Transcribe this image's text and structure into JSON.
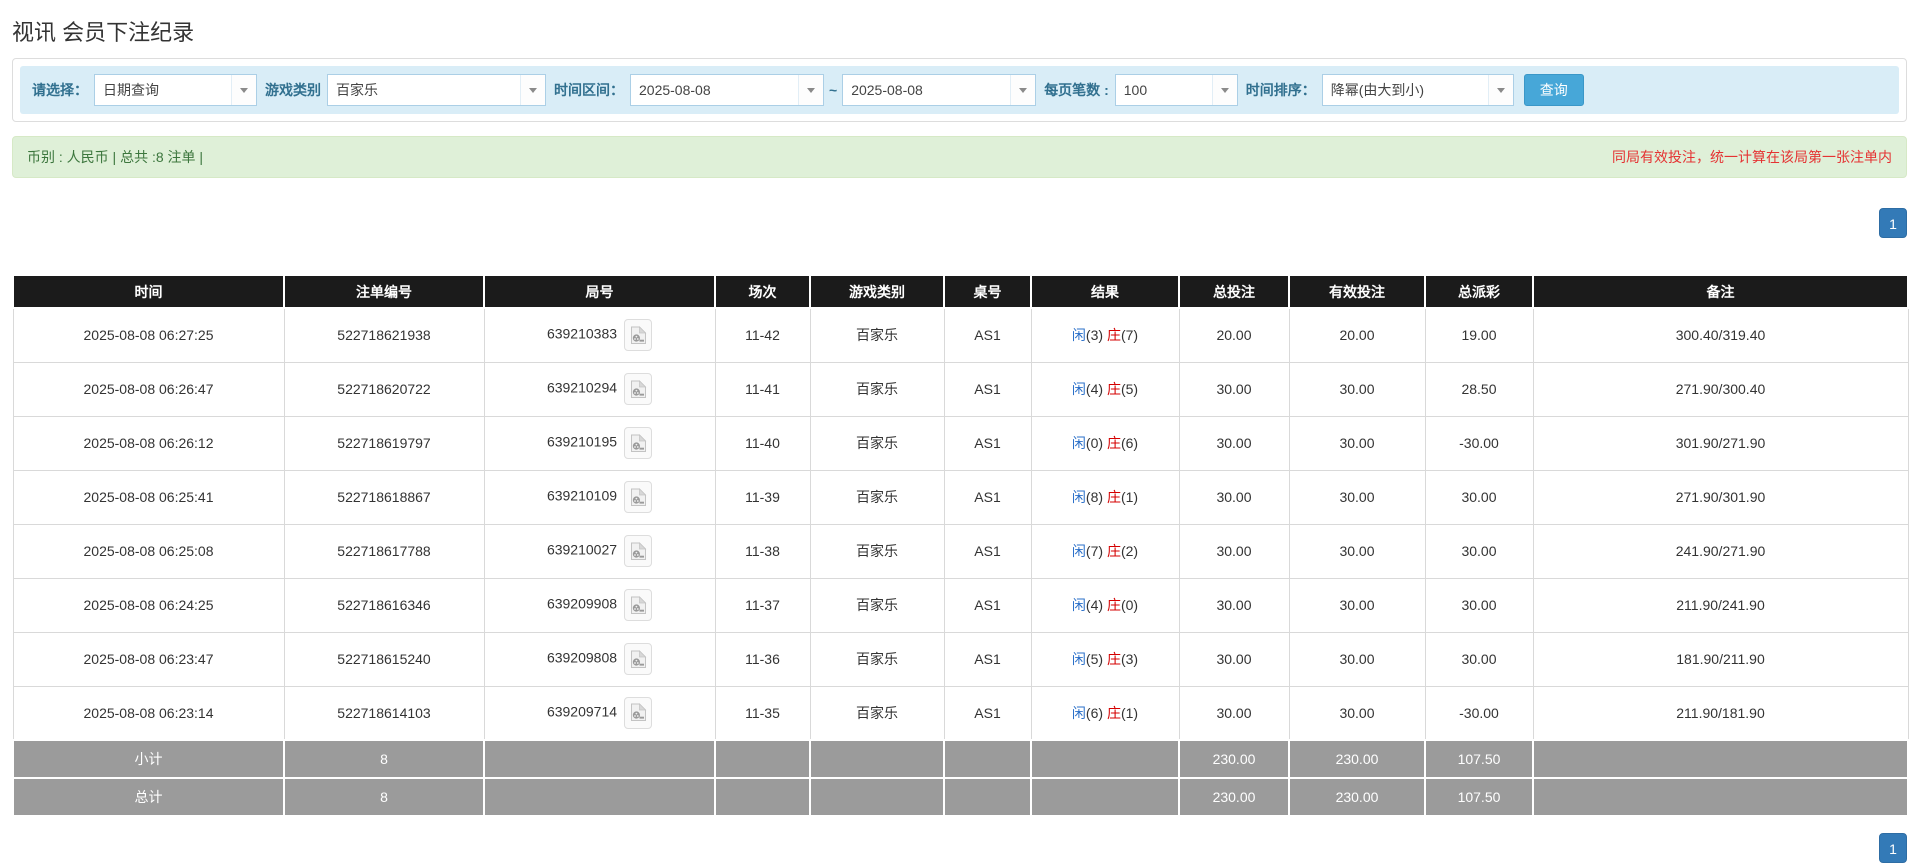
{
  "page": {
    "title": "视讯 会员下注纪录"
  },
  "filters": {
    "select_label": "请选择：",
    "select_value": "日期查询",
    "game_type_label": "游戏类别",
    "game_type_value": "百家乐",
    "date_range_label": "时间区间：",
    "date_from": "2025-08-08",
    "range_separator": "~",
    "date_to": "2025-08-08",
    "page_size_label": "每页笔数 :",
    "page_size_value": "100",
    "sort_label": "时间排序：",
    "sort_value": "降幂(由大到小)",
    "search_button": "查询"
  },
  "summary": {
    "left_text": "币别 : 人民币 | 总共 :8 注单 |",
    "right_text": "同局有效投注，统一计算在该局第一张注单内"
  },
  "pagination": {
    "current_page": "1"
  },
  "icons": {
    "video_icon": "video-clip-icon",
    "dropdown_icon": "chevron-down-icon"
  },
  "colors": {
    "accent_blue": "#47a7d8",
    "filter_bg": "#d9edf7",
    "filter_label": "#31708f",
    "summary_bg": "#dff0d8",
    "summary_text": "#3c763d",
    "warning_red": "#e53333",
    "header_bg": "#1b1b1b",
    "totals_bg": "#9b9b9b",
    "link_blue": "#337ab7",
    "player_blue": "#2a6fc9",
    "banker_red": "#d40000",
    "negative_red": "#e60000",
    "pager_blue": "#337ab7"
  },
  "table": {
    "headers": [
      "时间",
      "注单编号",
      "局号",
      "场次",
      "游戏类别",
      "桌号",
      "结果",
      "总投注",
      "有效投注",
      "总派彩",
      "备注"
    ],
    "rows": [
      {
        "time": "2025-08-08 06:27:25",
        "bet_id": "522718621938",
        "round_id": "639210383",
        "session": "11-42",
        "game": "百家乐",
        "table_no": "AS1",
        "player_label": "闲",
        "player_score": "(3)",
        "banker_label": "庄",
        "banker_score": "(7)",
        "total_bet": "20.00",
        "valid_bet": "20.00",
        "payout": "19.00",
        "remark": "300.40/319.40"
      },
      {
        "time": "2025-08-08 06:26:47",
        "bet_id": "522718620722",
        "round_id": "639210294",
        "session": "11-41",
        "game": "百家乐",
        "table_no": "AS1",
        "player_label": "闲",
        "player_score": "(4)",
        "banker_label": "庄",
        "banker_score": "(5)",
        "total_bet": "30.00",
        "valid_bet": "30.00",
        "payout": "28.50",
        "remark": "271.90/300.40"
      },
      {
        "time": "2025-08-08 06:26:12",
        "bet_id": "522718619797",
        "round_id": "639210195",
        "session": "11-40",
        "game": "百家乐",
        "table_no": "AS1",
        "player_label": "闲",
        "player_score": "(0)",
        "banker_label": "庄",
        "banker_score": "(6)",
        "total_bet": "30.00",
        "valid_bet": "30.00",
        "payout": "-30.00",
        "remark": "301.90/271.90"
      },
      {
        "time": "2025-08-08 06:25:41",
        "bet_id": "522718618867",
        "round_id": "639210109",
        "session": "11-39",
        "game": "百家乐",
        "table_no": "AS1",
        "player_label": "闲",
        "player_score": "(8)",
        "banker_label": "庄",
        "banker_score": "(1)",
        "total_bet": "30.00",
        "valid_bet": "30.00",
        "payout": "30.00",
        "remark": "271.90/301.90"
      },
      {
        "time": "2025-08-08 06:25:08",
        "bet_id": "522718617788",
        "round_id": "639210027",
        "session": "11-38",
        "game": "百家乐",
        "table_no": "AS1",
        "player_label": "闲",
        "player_score": "(7)",
        "banker_label": "庄",
        "banker_score": "(2)",
        "total_bet": "30.00",
        "valid_bet": "30.00",
        "payout": "30.00",
        "remark": "241.90/271.90"
      },
      {
        "time": "2025-08-08 06:24:25",
        "bet_id": "522718616346",
        "round_id": "639209908",
        "session": "11-37",
        "game": "百家乐",
        "table_no": "AS1",
        "player_label": "闲",
        "player_score": "(4)",
        "banker_label": "庄",
        "banker_score": "(0)",
        "total_bet": "30.00",
        "valid_bet": "30.00",
        "payout": "30.00",
        "remark": "211.90/241.90"
      },
      {
        "time": "2025-08-08 06:23:47",
        "bet_id": "522718615240",
        "round_id": "639209808",
        "session": "11-36",
        "game": "百家乐",
        "table_no": "AS1",
        "player_label": "闲",
        "player_score": "(5)",
        "banker_label": "庄",
        "banker_score": "(3)",
        "total_bet": "30.00",
        "valid_bet": "30.00",
        "payout": "30.00",
        "remark": "181.90/211.90"
      },
      {
        "time": "2025-08-08 06:23:14",
        "bet_id": "522718614103",
        "round_id": "639209714",
        "session": "11-35",
        "game": "百家乐",
        "table_no": "AS1",
        "player_label": "闲",
        "player_score": "(6)",
        "banker_label": "庄",
        "banker_score": "(1)",
        "total_bet": "30.00",
        "valid_bet": "30.00",
        "payout": "-30.00",
        "remark": "211.90/181.90"
      }
    ],
    "subtotal": {
      "label": "小计",
      "count": "8",
      "total_bet": "230.00",
      "valid_bet": "230.00",
      "payout": "107.50"
    },
    "total": {
      "label": "总计",
      "count": "8",
      "total_bet": "230.00",
      "valid_bet": "230.00",
      "payout": "107.50"
    }
  }
}
